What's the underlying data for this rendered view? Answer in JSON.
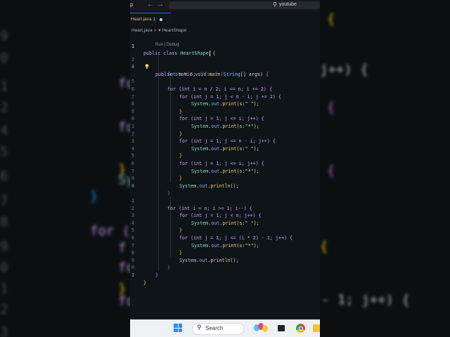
{
  "titlebar": {
    "app_letter": "p",
    "back_arrow": "←",
    "forward_arrow": "→",
    "search_icon": "search-icon",
    "search_text": "youtube"
  },
  "tab": {
    "label": "Heart.java 1"
  },
  "breadcrumb": {
    "file": "Heart.java",
    "separator": ">",
    "class_icon": "class-icon",
    "class": "HeartShape"
  },
  "codelens": "Run | Debug",
  "lines": {
    "l1": {
      "num": "1",
      "kw": "public class ",
      "cls": "HeartShape",
      "open": "{"
    },
    "l2": {
      "num": "2",
      "kw": "public static void ",
      "fn": "main",
      "p1": "(",
      "ty": "String",
      "rest": "[] args) ",
      "open": "{"
    },
    "l3": {
      "num": "3",
      "ty": "int",
      "var": " n = ",
      "num_val": "6",
      "semi": ";",
      "cmt": " // size"
    },
    "l4": {
      "num": "4"
    },
    "l5": {
      "num": "5",
      "text": "for (int i = n / 2; i <= n; i += 2) {"
    },
    "l6": {
      "num": "6",
      "text": "for (int j = 1; j < n - i; j += 2) {"
    },
    "l7": {
      "num": "7",
      "obj": "System",
      "dot1": ".",
      "fld": "out",
      "dot2": ".",
      "fn": "print",
      "args": "(s:\" \");"
    },
    "l8": {
      "num": "8",
      "close": "}"
    },
    "l9": {
      "num": "9",
      "text": "for (int j = 1; j <= i; j++) {"
    },
    "l10": {
      "num": "0",
      "obj": "System",
      "dot1": ".",
      "fld": "out",
      "dot2": ".",
      "fn": "print",
      "args": "(s:\"*\");"
    },
    "l11": {
      "num": "1",
      "close": "}"
    },
    "l12": {
      "num": "2",
      "text": "for (int j = 1; j <= n - i; j++) {"
    },
    "l13": {
      "num": "3",
      "obj": "System",
      "dot1": ".",
      "fld": "out",
      "dot2": ".",
      "fn": "print",
      "args": "(s:\" \");"
    },
    "l14": {
      "num": "4",
      "close": "}"
    },
    "l15": {
      "num": "5",
      "text": "for (int j = 1; j <= i; j++) {"
    },
    "l16": {
      "num": "6",
      "obj": "System",
      "dot1": ".",
      "fld": "out",
      "dot2": ".",
      "fn": "print",
      "args": "(s:\"*\");"
    },
    "l17": {
      "num": "7",
      "close": "}"
    },
    "l18": {
      "num": "8",
      "obj": "System",
      "dot1": ".",
      "fld": "out",
      "dot2": ".",
      "fn": "println",
      "args": "();"
    },
    "l19": {
      "num": "9",
      "close": "}"
    },
    "l20": {
      "num": "0"
    },
    "l21": {
      "num": "1",
      "text": "for (int i = n; i >= 1; i--) {"
    },
    "l22": {
      "num": "2",
      "text": "for (int j = 1; j < n; j++) {"
    },
    "l23": {
      "num": "3",
      "obj": "System",
      "dot1": ".",
      "fld": "out",
      "dot2": ".",
      "fn": "print",
      "args": "(s:\" \");"
    },
    "l24": {
      "num": "4",
      "close": "}"
    },
    "l25": {
      "num": "5",
      "text": "for (int j = 1; j <= (i * 2) - 1; j++) {"
    },
    "l26": {
      "num": "6",
      "obj": "System",
      "dot1": ".",
      "fld": "out",
      "dot2": ".",
      "fn": "print",
      "args": "(s:\"*\");"
    },
    "l27": {
      "num": "7",
      "close": "}"
    },
    "l28": {
      "num": "8",
      "obj": "System",
      "dot1": ".",
      "fld": "out",
      "dot2": ".",
      "fn": "println",
      "args": "();"
    },
    "l29": {
      "num": "9",
      "close": "}"
    },
    "l30": {
      "num": "0",
      "close": "}"
    },
    "l31": {
      "num": "1",
      "close": "}"
    },
    "l32": {
      "num": "2"
    }
  },
  "taskbar": {
    "start_icon": "windows-logo-icon",
    "search_icon": "search-icon",
    "search_label": "Search"
  },
  "background": {
    "left_fragments": [
      "9",
      "0",
      "1",
      "2",
      "3",
      "4",
      "5",
      "6",
      "7",
      "8",
      "9",
      "0",
      "1",
      "2",
      "3",
      "4",
      "5",
      "6"
    ],
    "left_code": [
      "for",
      "fo",
      "}",
      "Sy",
      "}",
      "for (i",
      "f",
      "fo",
      "}",
      "fo"
    ],
    "right_code": [
      "{",
      "j++) {",
      "{",
      "{",
      "{",
      "- 1; j++) {"
    ]
  }
}
